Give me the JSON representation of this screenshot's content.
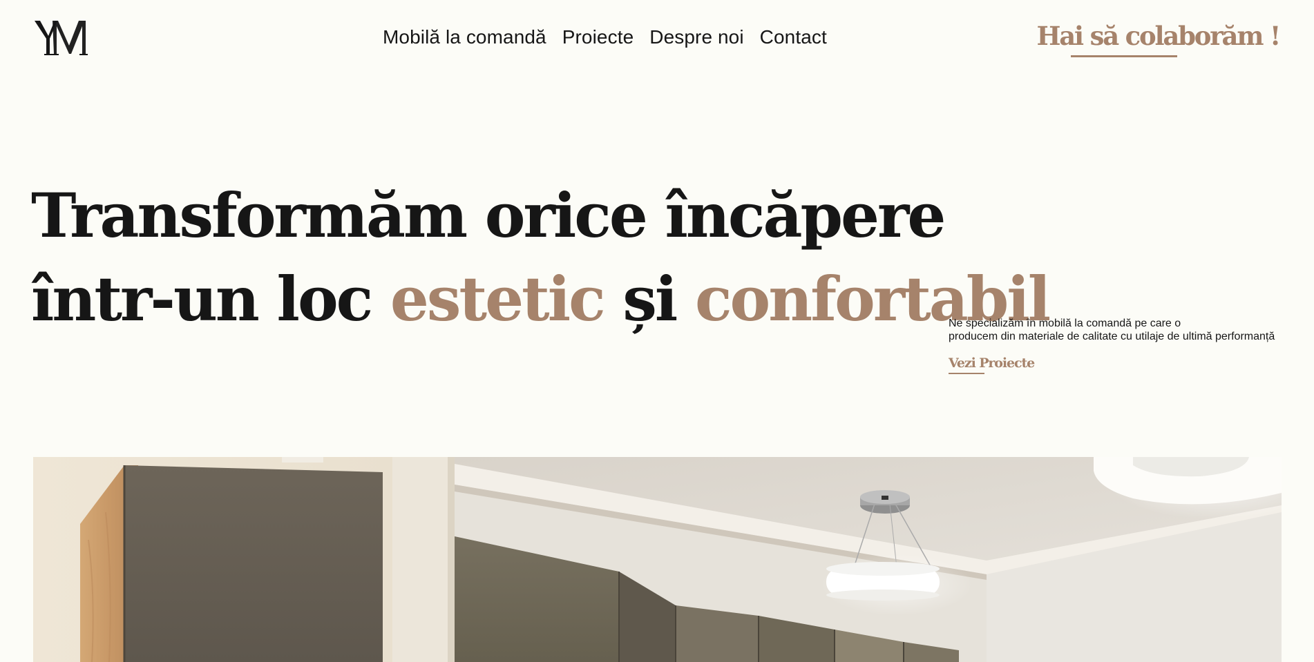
{
  "header": {
    "logo_text": "YM",
    "nav": [
      {
        "label": "Mobilă la comandă"
      },
      {
        "label": "Proiecte"
      },
      {
        "label": "Despre noi"
      },
      {
        "label": "Contact"
      }
    ],
    "cta_label": "Hai să colaborăm !"
  },
  "hero": {
    "title_line1": "Transformăm orice încăpere",
    "title_line2_start": "într-un loc ",
    "title_accent1": "estetic",
    "title_middle": " și ",
    "title_accent2": "confortabil",
    "description_line1": "Ne specializăm în mobilă la comandă pe care o",
    "description_line2": "producem din materiale de calitate cu utilaje de ultimă performanță",
    "link_label": "Vezi Proiecte"
  },
  "colors": {
    "background": "#fcfcf7",
    "accent": "#a6836b",
    "text": "#161616"
  },
  "icons": {
    "logo": "ym-monogram-logo"
  }
}
